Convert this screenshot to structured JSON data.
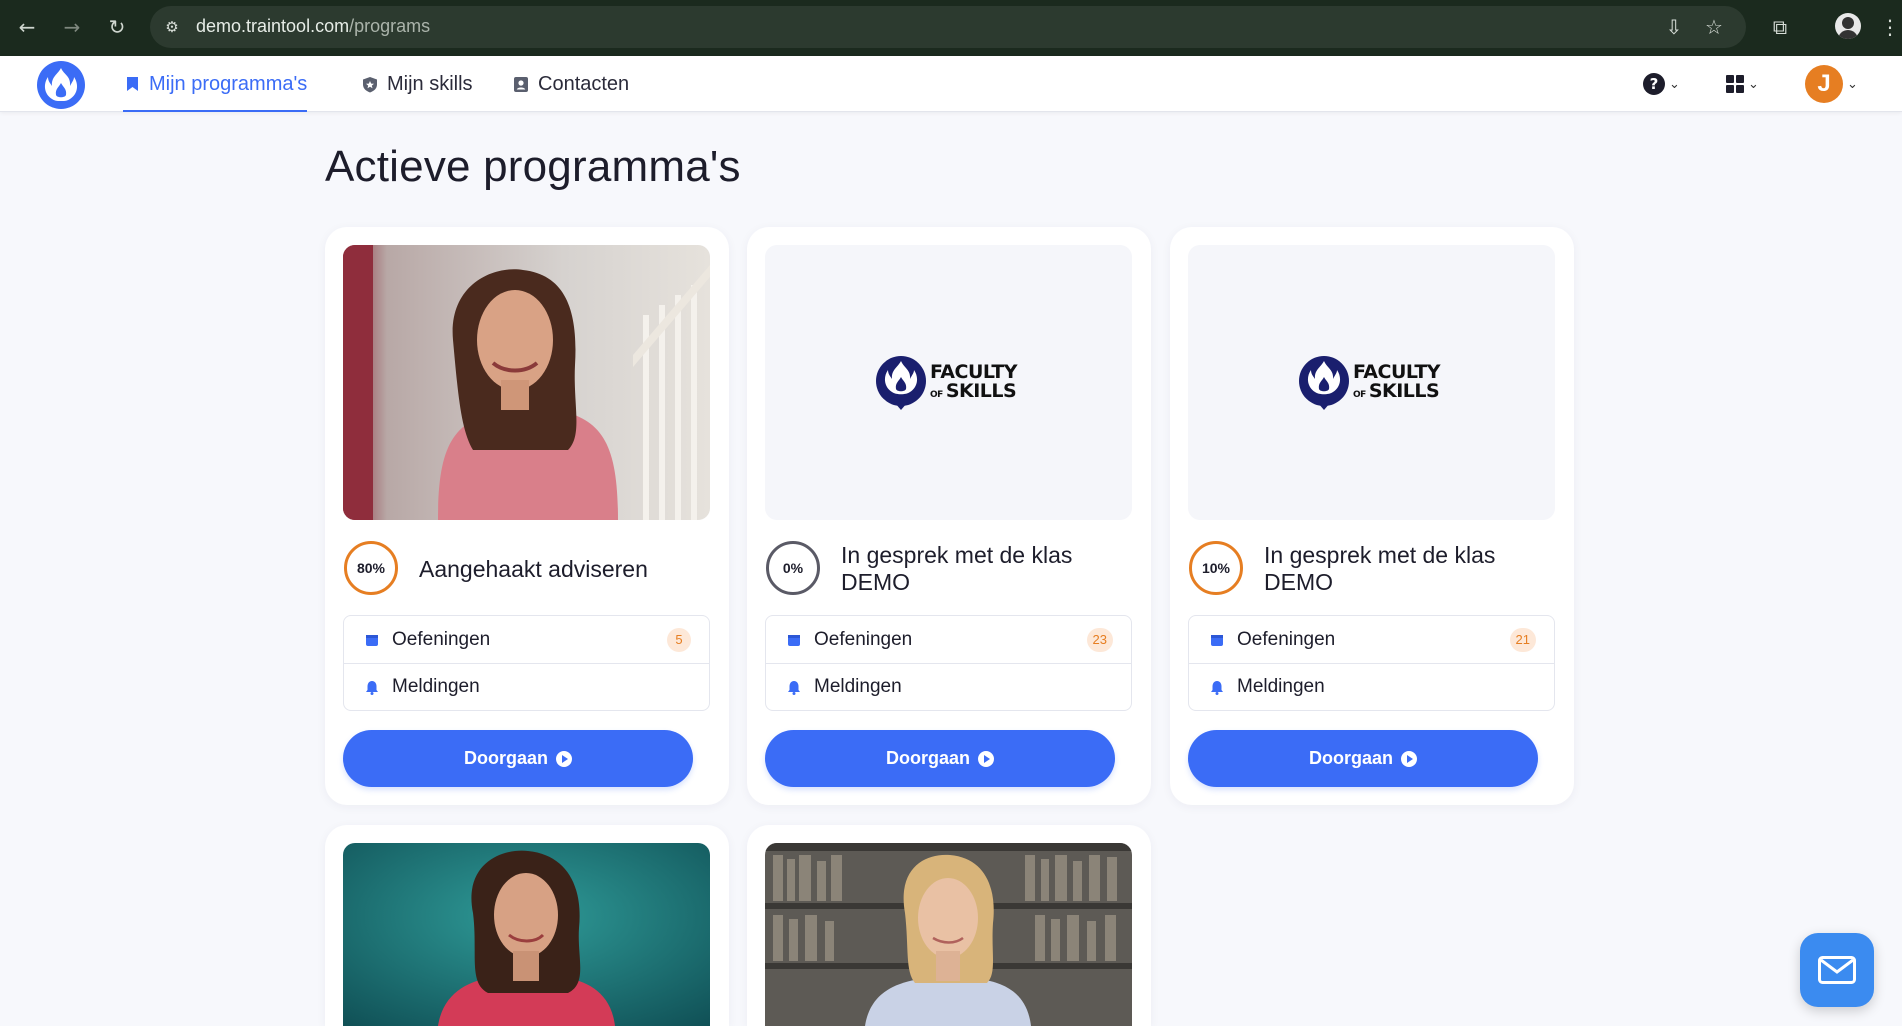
{
  "browser": {
    "url_host": "demo.traintool.com",
    "url_path": "/programs"
  },
  "nav": {
    "tabs": [
      {
        "label": "Mijn programma's",
        "icon": "bookmark-icon",
        "active": true
      },
      {
        "label": "Mijn skills",
        "icon": "shield-star-icon",
        "active": false
      },
      {
        "label": "Contacten",
        "icon": "contacts-icon",
        "active": false
      }
    ],
    "avatar_initial": "J",
    "help_glyph": "?"
  },
  "page": {
    "title": "Actieve programma's"
  },
  "logo_text": {
    "line1": "FACULTY",
    "of": "OF",
    "line2": "SKILLS"
  },
  "programs": [
    {
      "title": "Aangehaakt adviseren",
      "progress_label": "80%",
      "progress": 0.8,
      "exercises_label": "Oefeningen",
      "exercises_count": "5",
      "notifications_label": "Meldingen",
      "cta": "Doorgaan",
      "media": "video-woman-pink"
    },
    {
      "title": "In gesprek met de klas DEMO",
      "progress_label": "0%",
      "progress": 0.0,
      "exercises_label": "Oefeningen",
      "exercises_count": "23",
      "notifications_label": "Meldingen",
      "cta": "Doorgaan",
      "media": "faculty-of-skills-logo"
    },
    {
      "title": "In gesprek met de klas DEMO",
      "progress_label": "10%",
      "progress": 0.1,
      "exercises_label": "Oefeningen",
      "exercises_count": "21",
      "notifications_label": "Meldingen",
      "cta": "Doorgaan",
      "media": "faculty-of-skills-logo"
    },
    {
      "media": "video-woman-teal"
    },
    {
      "media": "video-woman-library"
    }
  ],
  "colors": {
    "accent": "#3b6cf6",
    "progress_orange": "#e67e22",
    "progress_grey": "#5a5a66"
  }
}
